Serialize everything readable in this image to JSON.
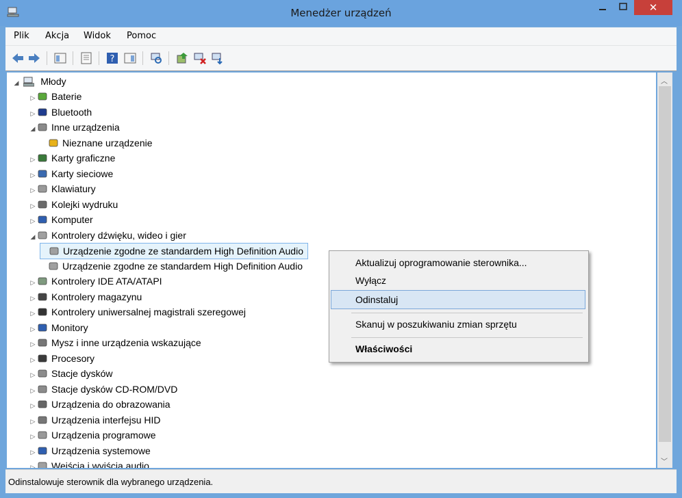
{
  "window": {
    "title": "Menedżer urządzeń",
    "close_glyph": "✕"
  },
  "menubar": {
    "items": [
      "Plik",
      "Akcja",
      "Widok",
      "Pomoc"
    ]
  },
  "toolbar": {
    "icons": [
      "back-arrow-icon",
      "forward-arrow-icon",
      "properties-icon",
      "tree-view-icon",
      "help-icon",
      "details-icon",
      "scan-hardware-icon",
      "update-driver-icon",
      "disable-device-icon",
      "uninstall-device-icon"
    ]
  },
  "tree": {
    "root": "Młody",
    "items": [
      {
        "label": "Baterie",
        "icon": "battery-icon",
        "expand": "▷"
      },
      {
        "label": "Bluetooth",
        "icon": "bluetooth-icon",
        "expand": "▷"
      },
      {
        "label": "Inne urządzenia",
        "icon": "other-devices-icon",
        "expand": "◢"
      },
      {
        "label": "Nieznane urządzenie",
        "icon": "warning-device-icon",
        "expand": ""
      },
      {
        "label": "Karty graficzne",
        "icon": "display-adapter-icon",
        "expand": "▷"
      },
      {
        "label": "Karty sieciowe",
        "icon": "network-adapter-icon",
        "expand": "▷"
      },
      {
        "label": "Klawiatury",
        "icon": "keyboard-icon",
        "expand": "▷"
      },
      {
        "label": "Kolejki wydruku",
        "icon": "printer-icon",
        "expand": "▷"
      },
      {
        "label": "Komputer",
        "icon": "computer-icon",
        "expand": "▷"
      },
      {
        "label": "Kontrolery dźwięku, wideo i gier",
        "icon": "speaker-icon",
        "expand": "◢"
      },
      {
        "label": "Urządzenie zgodne ze standardem High Definition Audio",
        "icon": "speaker-icon",
        "expand": ""
      },
      {
        "label": "Urządzenie zgodne ze standardem High Definition Audio",
        "icon": "speaker-icon",
        "expand": ""
      },
      {
        "label": "Kontrolery IDE ATA/ATAPI",
        "icon": "ide-controller-icon",
        "expand": "▷"
      },
      {
        "label": "Kontrolery magazynu",
        "icon": "storage-controller-icon",
        "expand": "▷"
      },
      {
        "label": "Kontrolery uniwersalnej magistrali szeregowej",
        "icon": "usb-icon",
        "expand": "▷"
      },
      {
        "label": "Monitory",
        "icon": "monitor-icon",
        "expand": "▷"
      },
      {
        "label": "Mysz i inne urządzenia wskazujące",
        "icon": "mouse-icon",
        "expand": "▷"
      },
      {
        "label": "Procesory",
        "icon": "processor-icon",
        "expand": "▷"
      },
      {
        "label": "Stacje dysków",
        "icon": "disk-drive-icon",
        "expand": "▷"
      },
      {
        "label": "Stacje dysków CD-ROM/DVD",
        "icon": "cdrom-icon",
        "expand": "▷"
      },
      {
        "label": "Urządzenia do obrazowania",
        "icon": "imaging-icon",
        "expand": "▷"
      },
      {
        "label": "Urządzenia interfejsu HID",
        "icon": "hid-icon",
        "expand": "▷"
      },
      {
        "label": "Urządzenia programowe",
        "icon": "software-device-icon",
        "expand": "▷"
      },
      {
        "label": "Urządzenia systemowe",
        "icon": "system-device-icon",
        "expand": "▷"
      },
      {
        "label": "Wejścia i wyjścia audio",
        "icon": "audio-io-icon",
        "expand": "▷"
      }
    ]
  },
  "context_menu": {
    "items": [
      {
        "label": "Aktualizuj oprogramowanie sterownika...",
        "bold": false
      },
      {
        "label": "Wyłącz",
        "bold": false
      },
      {
        "label": "Odinstaluj",
        "bold": false,
        "highlighted": true
      },
      {
        "label": "Skanuj w poszukiwaniu zmian sprzętu",
        "bold": false
      },
      {
        "label": "Właściwości",
        "bold": true
      }
    ]
  },
  "statusbar": {
    "text": "Odinstalowuje sterownik dla wybranego urządzenia."
  },
  "colors": {
    "titlebar": "#6aa3de",
    "close": "#c7403a",
    "selection": "#e5f3fb",
    "menu_highlight": "#d8e6f4"
  }
}
